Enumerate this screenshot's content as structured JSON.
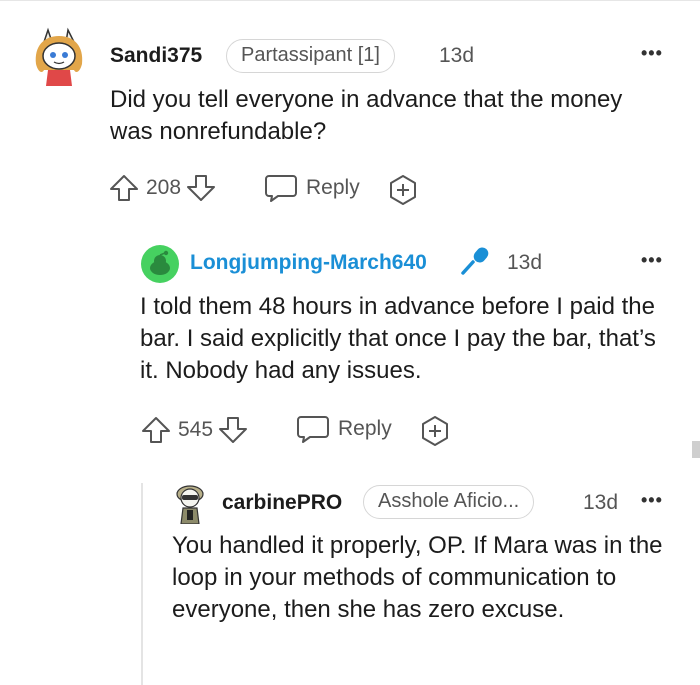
{
  "comments": [
    {
      "username": "Sandi375",
      "flair": "Partassipant [1]",
      "time": "13d",
      "body": "Did you tell everyone in advance that the money was nonrefundable?",
      "votes": "208",
      "reply_label": "Reply"
    },
    {
      "username": "Longjumping-March640",
      "time": "13d",
      "body": "I told them 48 hours in advance before I paid the bar. I said explicitly that once I pay the bar, that’s it. Nobody had any issues.",
      "votes": "545",
      "reply_label": "Reply"
    },
    {
      "username": "carbinePRO",
      "flair": "Asshole Aficio...",
      "time": "13d",
      "body": "You handled it properly, OP. If Mara was in the loop in your methods of communication to everyone, then she has zero excuse."
    }
  ],
  "more_label": "•••",
  "colors": {
    "op_username": "#1a8fd6",
    "op_mic": "#1a8fd6",
    "snoo_green": "#46d160"
  }
}
